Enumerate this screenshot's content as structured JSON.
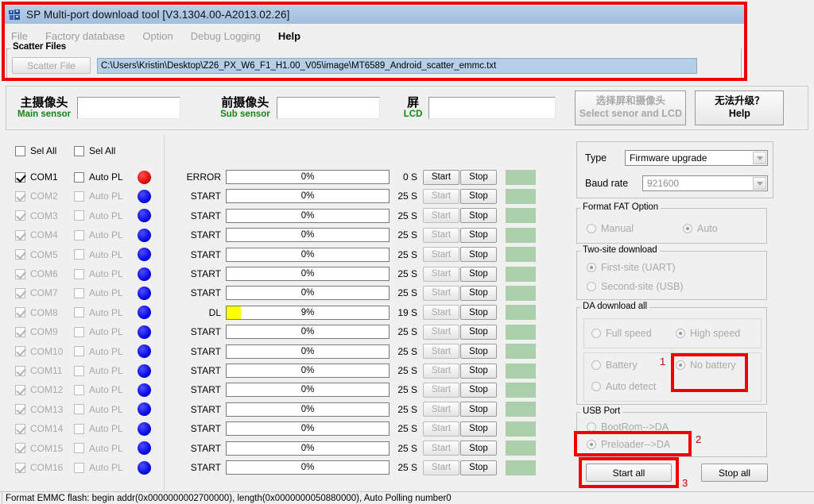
{
  "window": {
    "title": "SP Multi-port download tool [V3.1304.00-A2013.02.26]",
    "app_icon": "app-icon"
  },
  "menu": {
    "items": [
      {
        "label": "File",
        "enabled": false
      },
      {
        "label": "Factory database",
        "enabled": false
      },
      {
        "label": "Option",
        "enabled": false
      },
      {
        "label": "Debug Logging",
        "enabled": false
      },
      {
        "label": "Help",
        "enabled": true
      }
    ]
  },
  "scatter": {
    "group_label": "Scatter Files",
    "button_label": "Scatter File",
    "path": "C:\\Users\\Kristin\\Desktop\\Z26_PX_W6_F1_H1.00_V05\\image\\MT6589_Android_scatter_emmc.txt"
  },
  "sensors": {
    "main": {
      "cn": "主摄像头",
      "en": "Main sensor",
      "value": ""
    },
    "sub": {
      "cn": "前摄像头",
      "en": "Sub sensor",
      "value": ""
    },
    "lcd": {
      "cn": "屏",
      "en": "LCD",
      "value": ""
    },
    "select_button": {
      "cn": "选择屏和摄像头",
      "en": "Select senor and LCD"
    },
    "help_button": {
      "cn": "无法升级？",
      "en": "Help"
    }
  },
  "ports": {
    "sel_all_left": "Sel All",
    "sel_all_right": "Sel All",
    "rows": [
      {
        "com": "COM1",
        "auto": "Auto PL",
        "led": "red",
        "enabled": true
      },
      {
        "com": "COM2",
        "auto": "Auto PL",
        "led": "blue",
        "enabled": false
      },
      {
        "com": "COM3",
        "auto": "Auto PL",
        "led": "blue",
        "enabled": false
      },
      {
        "com": "COM4",
        "auto": "Auto PL",
        "led": "blue",
        "enabled": false
      },
      {
        "com": "COM5",
        "auto": "Auto PL",
        "led": "blue",
        "enabled": false
      },
      {
        "com": "COM6",
        "auto": "Auto PL",
        "led": "blue",
        "enabled": false
      },
      {
        "com": "COM7",
        "auto": "Auto PL",
        "led": "blue",
        "enabled": false
      },
      {
        "com": "COM8",
        "auto": "Auto PL",
        "led": "blue",
        "enabled": false
      },
      {
        "com": "COM9",
        "auto": "Auto PL",
        "led": "blue",
        "enabled": false
      },
      {
        "com": "COM10",
        "auto": "Auto PL",
        "led": "blue",
        "enabled": false
      },
      {
        "com": "COM11",
        "auto": "Auto PL",
        "led": "blue",
        "enabled": false
      },
      {
        "com": "COM12",
        "auto": "Auto PL",
        "led": "blue",
        "enabled": false
      },
      {
        "com": "COM13",
        "auto": "Auto PL",
        "led": "blue",
        "enabled": false
      },
      {
        "com": "COM14",
        "auto": "Auto PL",
        "led": "blue",
        "enabled": false
      },
      {
        "com": "COM15",
        "auto": "Auto PL",
        "led": "blue",
        "enabled": false
      },
      {
        "com": "COM16",
        "auto": "Auto PL",
        "led": "blue",
        "enabled": false
      }
    ]
  },
  "progress": {
    "start_label": "Start",
    "stop_label": "Stop",
    "rows": [
      {
        "state": "ERROR",
        "percent": "0%",
        "fill": 0,
        "time": "0 S",
        "start_enabled": true
      },
      {
        "state": "START",
        "percent": "0%",
        "fill": 0,
        "time": "25 S",
        "start_enabled": false
      },
      {
        "state": "START",
        "percent": "0%",
        "fill": 0,
        "time": "25 S",
        "start_enabled": false
      },
      {
        "state": "START",
        "percent": "0%",
        "fill": 0,
        "time": "25 S",
        "start_enabled": false
      },
      {
        "state": "START",
        "percent": "0%",
        "fill": 0,
        "time": "25 S",
        "start_enabled": false
      },
      {
        "state": "START",
        "percent": "0%",
        "fill": 0,
        "time": "25 S",
        "start_enabled": false
      },
      {
        "state": "START",
        "percent": "0%",
        "fill": 0,
        "time": "25 S",
        "start_enabled": false
      },
      {
        "state": "DL",
        "percent": "9%",
        "fill": 9,
        "time": "19 S",
        "start_enabled": false
      },
      {
        "state": "START",
        "percent": "0%",
        "fill": 0,
        "time": "25 S",
        "start_enabled": false
      },
      {
        "state": "START",
        "percent": "0%",
        "fill": 0,
        "time": "25 S",
        "start_enabled": false
      },
      {
        "state": "START",
        "percent": "0%",
        "fill": 0,
        "time": "25 S",
        "start_enabled": false
      },
      {
        "state": "START",
        "percent": "0%",
        "fill": 0,
        "time": "25 S",
        "start_enabled": false
      },
      {
        "state": "START",
        "percent": "0%",
        "fill": 0,
        "time": "25 S",
        "start_enabled": false
      },
      {
        "state": "START",
        "percent": "0%",
        "fill": 0,
        "time": "25 S",
        "start_enabled": false
      },
      {
        "state": "START",
        "percent": "0%",
        "fill": 0,
        "time": "25 S",
        "start_enabled": false
      },
      {
        "state": "START",
        "percent": "0%",
        "fill": 0,
        "time": "25 S",
        "start_enabled": false
      }
    ]
  },
  "settings": {
    "type_label": "Type",
    "type_value": "Firmware upgrade",
    "baud_label": "Baud rate",
    "baud_value": "921600",
    "format_fat": {
      "title": "Format FAT Option",
      "manual": "Manual",
      "auto": "Auto",
      "selected": "auto"
    },
    "two_site": {
      "title": "Two-site download",
      "first": "First-site (UART)",
      "second": "Second-site (USB)",
      "selected": "first"
    },
    "da_download": {
      "title": "DA download all",
      "full_speed": "Full speed",
      "high_speed": "High speed",
      "speed_selected": "high",
      "battery": "Battery",
      "no_battery": "No battery",
      "auto_detect": "Auto detect",
      "battery_selected": "no_battery"
    },
    "usb_port": {
      "title": "USB Port",
      "bootrom": "BootRom-->DA",
      "preloader": "Preloader-->DA",
      "selected": "preloader"
    },
    "start_all": "Start all",
    "stop_all": "Stop all"
  },
  "annotations": {
    "accent_color": "#ee0000",
    "number_color": "#c00000",
    "markers": [
      {
        "label": "1",
        "target": "no-battery-radio"
      },
      {
        "label": "2",
        "target": "preloader-radio"
      },
      {
        "label": "3",
        "target": "start-all-button"
      }
    ]
  },
  "statusbar": {
    "text": "Format EMMC flash: begin addr(0x0000000002700000), length(0x0000000050880000), Auto Polling number0"
  }
}
